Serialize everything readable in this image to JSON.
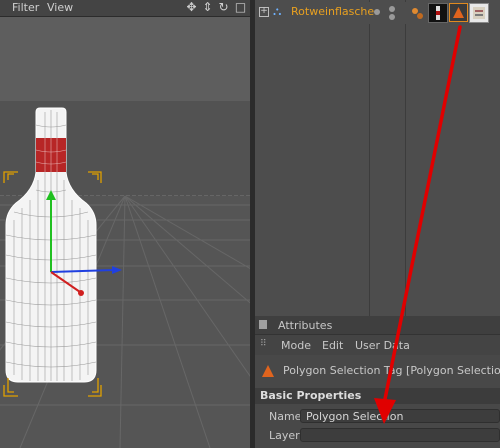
{
  "viewport": {
    "menu": {
      "filter_label": "Filter",
      "view_label": "View"
    },
    "nav_icons": [
      "move-icon",
      "arrows-icon",
      "rotate-icon",
      "maximize-icon"
    ]
  },
  "object_manager": {
    "object_name": "Rotweinflasche",
    "object_color": "#e8a020",
    "tags": [
      "phong-tag-icon",
      "material-tag-icon",
      "polygon-selection-tag-icon",
      "texture-tag-icon"
    ]
  },
  "attributes": {
    "panel_title": "Attributes",
    "menu": {
      "mode": "Mode",
      "edit": "Edit",
      "user_data": "User Data"
    },
    "object_title": "Polygon Selection Tag [Polygon Selection]",
    "section_title": "Basic Properties",
    "fields": {
      "name_label": "Name",
      "name_value": "Polygon Selection",
      "layer_label": "Layer",
      "layer_value": ""
    }
  },
  "colors": {
    "annotation_arrow": "#e00000",
    "selection_orange": "#e0a000",
    "label_red": "#b01010"
  }
}
